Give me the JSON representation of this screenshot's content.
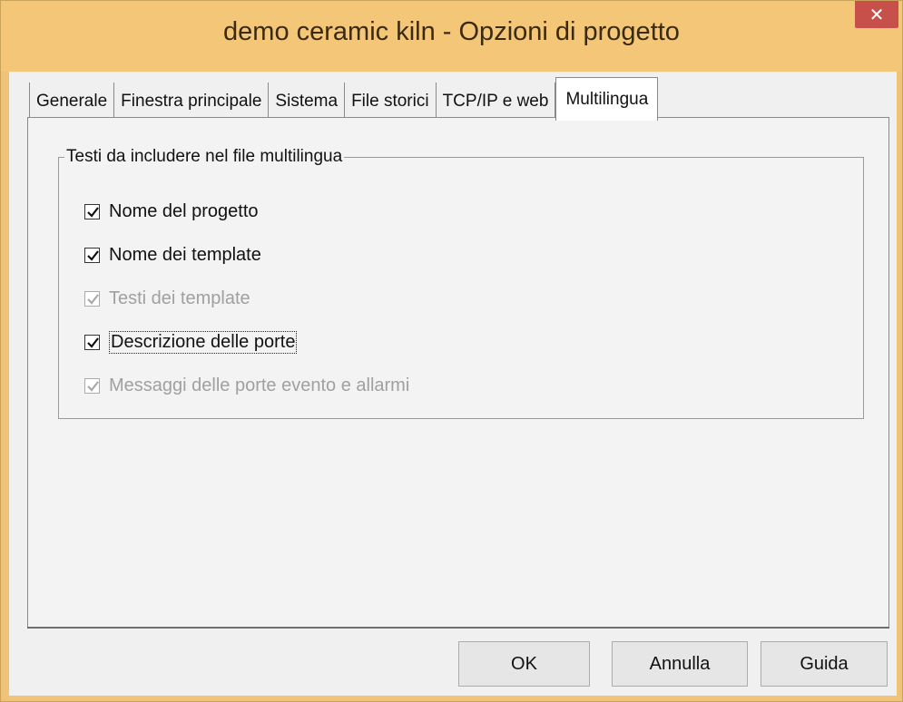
{
  "window": {
    "title": "demo ceramic kiln - Opzioni di progetto",
    "close_label": "✕"
  },
  "tabs": [
    {
      "label": "Generale",
      "active": false
    },
    {
      "label": "Finestra principale",
      "active": false
    },
    {
      "label": "Sistema",
      "active": false
    },
    {
      "label": "File storici",
      "active": false
    },
    {
      "label": "TCP/IP e web",
      "active": false
    },
    {
      "label": "Multilingua",
      "active": true
    }
  ],
  "group": {
    "title": "Testi da includere nel file multilingua",
    "items": [
      {
        "label": "Nome del progetto",
        "checked": true,
        "enabled": true
      },
      {
        "label": "Nome dei template",
        "checked": true,
        "enabled": true
      },
      {
        "label": "Testi dei template",
        "checked": true,
        "enabled": false
      },
      {
        "label": "Descrizione delle porte",
        "checked": true,
        "enabled": true,
        "focused": true
      },
      {
        "label": "Messaggi delle porte evento e allarmi",
        "checked": true,
        "enabled": false
      }
    ]
  },
  "buttons": {
    "ok": "OK",
    "cancel": "Annulla",
    "help": "Guida"
  },
  "colors": {
    "titlebar": "#f3c777",
    "close_button": "#c7504a",
    "client_bg": "#f0f0f0"
  }
}
